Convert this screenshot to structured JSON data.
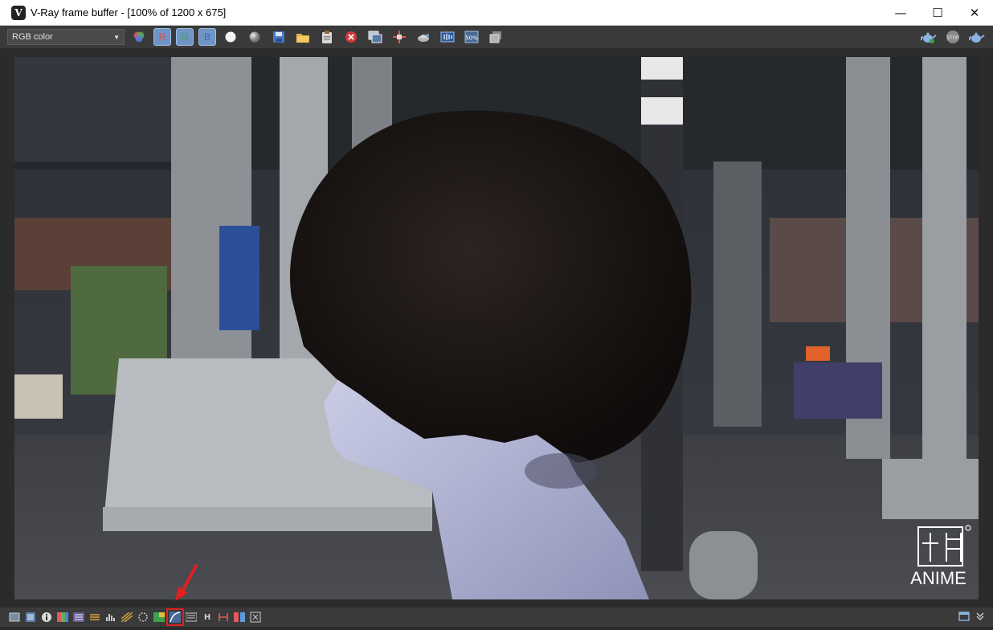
{
  "window": {
    "title": "V-Ray frame buffer - [100% of 1200 x 675]",
    "app_icon_letter": "V",
    "controls": {
      "minimize": "—",
      "maximize": "☐",
      "close": "✕"
    }
  },
  "toolbar": {
    "channel_value": "RGB color",
    "channel_caret": "▼",
    "red_label": "R",
    "green_label": "G",
    "blue_label": "B",
    "zoom_label": "50%"
  },
  "watermark": {
    "logo_text": "ANIME"
  },
  "colors": {
    "accent_highlight": "#e02020",
    "toolbar_bg": "#3a3a3a",
    "title_bg": "#ffffff"
  },
  "bottom_toolbar": {
    "h_label": "H"
  }
}
